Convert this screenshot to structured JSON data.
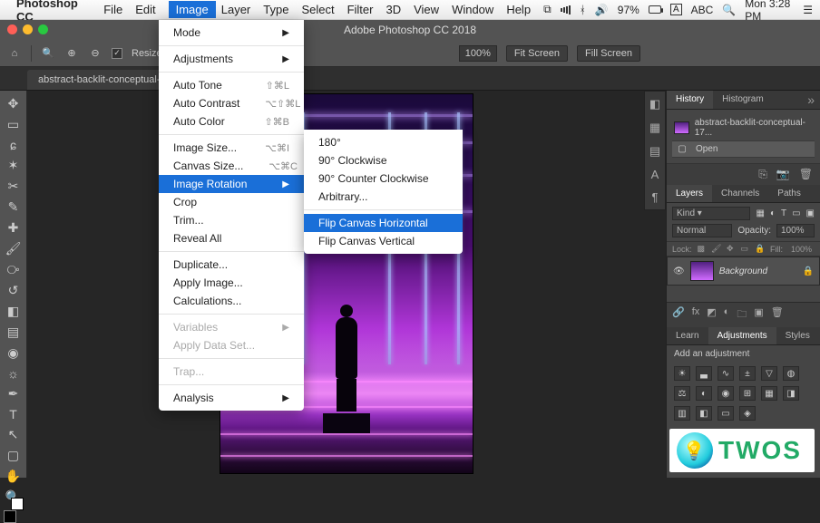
{
  "mac_menu": {
    "app_name": "Photoshop CC",
    "items": [
      "File",
      "Edit",
      "Image",
      "Layer",
      "Type",
      "Select",
      "Filter",
      "3D",
      "View",
      "Window",
      "Help"
    ],
    "active_index": 2,
    "status_percent": "97%",
    "status_user": "ABC",
    "status_time": "Mon 3:28 PM"
  },
  "titlebar": {
    "title": "Adobe Photoshop CC 2018"
  },
  "options_bar": {
    "resize_checkbox_label": "Resize Windows to Fit",
    "zoom_display": "100%",
    "fit_screen": "Fit Screen",
    "fill_screen": "Fill Screen"
  },
  "doc_tab": {
    "label": "abstract-backlit-conceptual-17..."
  },
  "image_menu": {
    "groups": [
      [
        {
          "label": "Mode",
          "submenu": true
        }
      ],
      [
        {
          "label": "Adjustments",
          "submenu": true
        }
      ],
      [
        {
          "label": "Auto Tone",
          "shortcut": "⇧⌘L"
        },
        {
          "label": "Auto Contrast",
          "shortcut": "⌥⇧⌘L"
        },
        {
          "label": "Auto Color",
          "shortcut": "⇧⌘B"
        }
      ],
      [
        {
          "label": "Image Size...",
          "shortcut": "⌥⌘I"
        },
        {
          "label": "Canvas Size...",
          "shortcut": "⌥⌘C"
        },
        {
          "label": "Image Rotation",
          "submenu": true,
          "highlight": true
        },
        {
          "label": "Crop"
        },
        {
          "label": "Trim..."
        },
        {
          "label": "Reveal All"
        }
      ],
      [
        {
          "label": "Duplicate..."
        },
        {
          "label": "Apply Image..."
        },
        {
          "label": "Calculations..."
        }
      ],
      [
        {
          "label": "Variables",
          "submenu": true,
          "disabled": true
        },
        {
          "label": "Apply Data Set...",
          "disabled": true
        }
      ],
      [
        {
          "label": "Trap...",
          "disabled": true
        }
      ],
      [
        {
          "label": "Analysis",
          "submenu": true
        }
      ]
    ]
  },
  "rotation_submenu": {
    "items": [
      {
        "label": "180°"
      },
      {
        "label": "90° Clockwise"
      },
      {
        "label": "90° Counter Clockwise"
      },
      {
        "label": "Arbitrary..."
      },
      {
        "sep": true
      },
      {
        "label": "Flip Canvas Horizontal",
        "highlight": true
      },
      {
        "label": "Flip Canvas Vertical"
      }
    ]
  },
  "history_panel": {
    "tabs": [
      "History",
      "Histogram"
    ],
    "active_tab": 0,
    "entries": [
      {
        "label": "abstract-backlit-conceptual-17..."
      },
      {
        "label": "Open"
      }
    ]
  },
  "layers_panel": {
    "tabs": [
      "Layers",
      "Channels",
      "Paths"
    ],
    "active_tab": 0,
    "kind_label": "Kind",
    "blend_mode": "Normal",
    "opacity_label": "Opacity:",
    "opacity_value": "100%",
    "lock_label": "Lock:",
    "fill_label": "Fill:",
    "fill_value": "100%",
    "layer": {
      "name": "Background"
    }
  },
  "adjustments_panel": {
    "tabs": [
      "Learn",
      "Adjustments",
      "Styles"
    ],
    "active_tab": 1,
    "hint": "Add an adjustment"
  },
  "watermark": {
    "text": "TWOS"
  }
}
